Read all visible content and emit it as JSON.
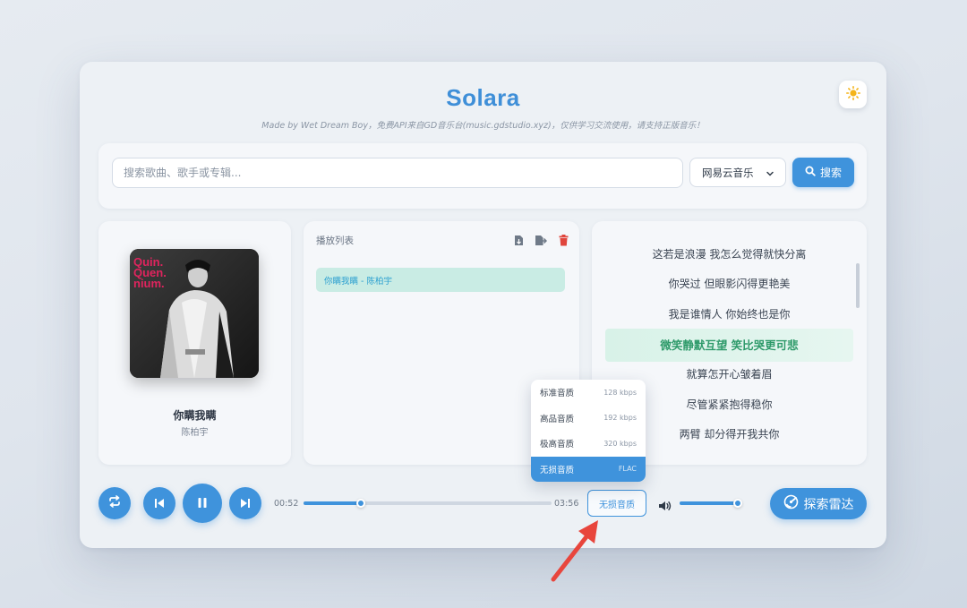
{
  "app": {
    "title": "Solara",
    "subtitle": "Made by Wet Dream Boy，免费API来自GD音乐台(music.gdstudio.xyz)，仅供学习交流使用，请支持正版音乐！"
  },
  "search": {
    "placeholder": "搜索歌曲、歌手或专辑...",
    "source": "网易云音乐",
    "button_label": "搜索"
  },
  "now_playing": {
    "title": "你瞒我瞒",
    "artist": "陈柏宇",
    "cover_text": [
      "Quin.",
      "Quen.",
      "nium."
    ]
  },
  "playlist": {
    "header": "播放列表",
    "items": [
      {
        "label": "你瞒我瞒 - 陈柏宇"
      }
    ]
  },
  "lyrics": {
    "lines": [
      "这若是浪漫 我怎么觉得就快分离",
      "你哭过 但眼影闪得更艳美",
      "我是谁情人 你始终也是你",
      "微笑静默互望 笑比哭更可悲",
      "就算怎开心皱着眉",
      "尽管紧紧抱得稳你",
      "两臂 却分得开我共你"
    ],
    "active_index": 3
  },
  "player": {
    "current_time": "00:52",
    "duration": "03:56",
    "progress": 0.23,
    "volume": 1.0,
    "quality_label": "无损音质",
    "explore_label": "探索雷达"
  },
  "quality_menu": {
    "options": [
      {
        "label": "标准音质",
        "rate": "128 kbps"
      },
      {
        "label": "高品音质",
        "rate": "192 kbps"
      },
      {
        "label": "极高音质",
        "rate": "320 kbps"
      },
      {
        "label": "无损音质",
        "rate": "FLAC"
      }
    ],
    "selected_index": 3
  },
  "colors": {
    "accent": "#3f93dc",
    "title": "#3f8fd8",
    "active_lyric": "#2e9a6a",
    "annotation_arrow": "#e8453c"
  },
  "icons": {
    "theme": "sun-icon",
    "search": "search-icon",
    "repeat": "repeat-icon",
    "previous": "skip-previous-icon",
    "play_pause": "pause-icon",
    "next": "skip-next-icon",
    "volume": "volume-icon",
    "explore": "radar-icon"
  }
}
